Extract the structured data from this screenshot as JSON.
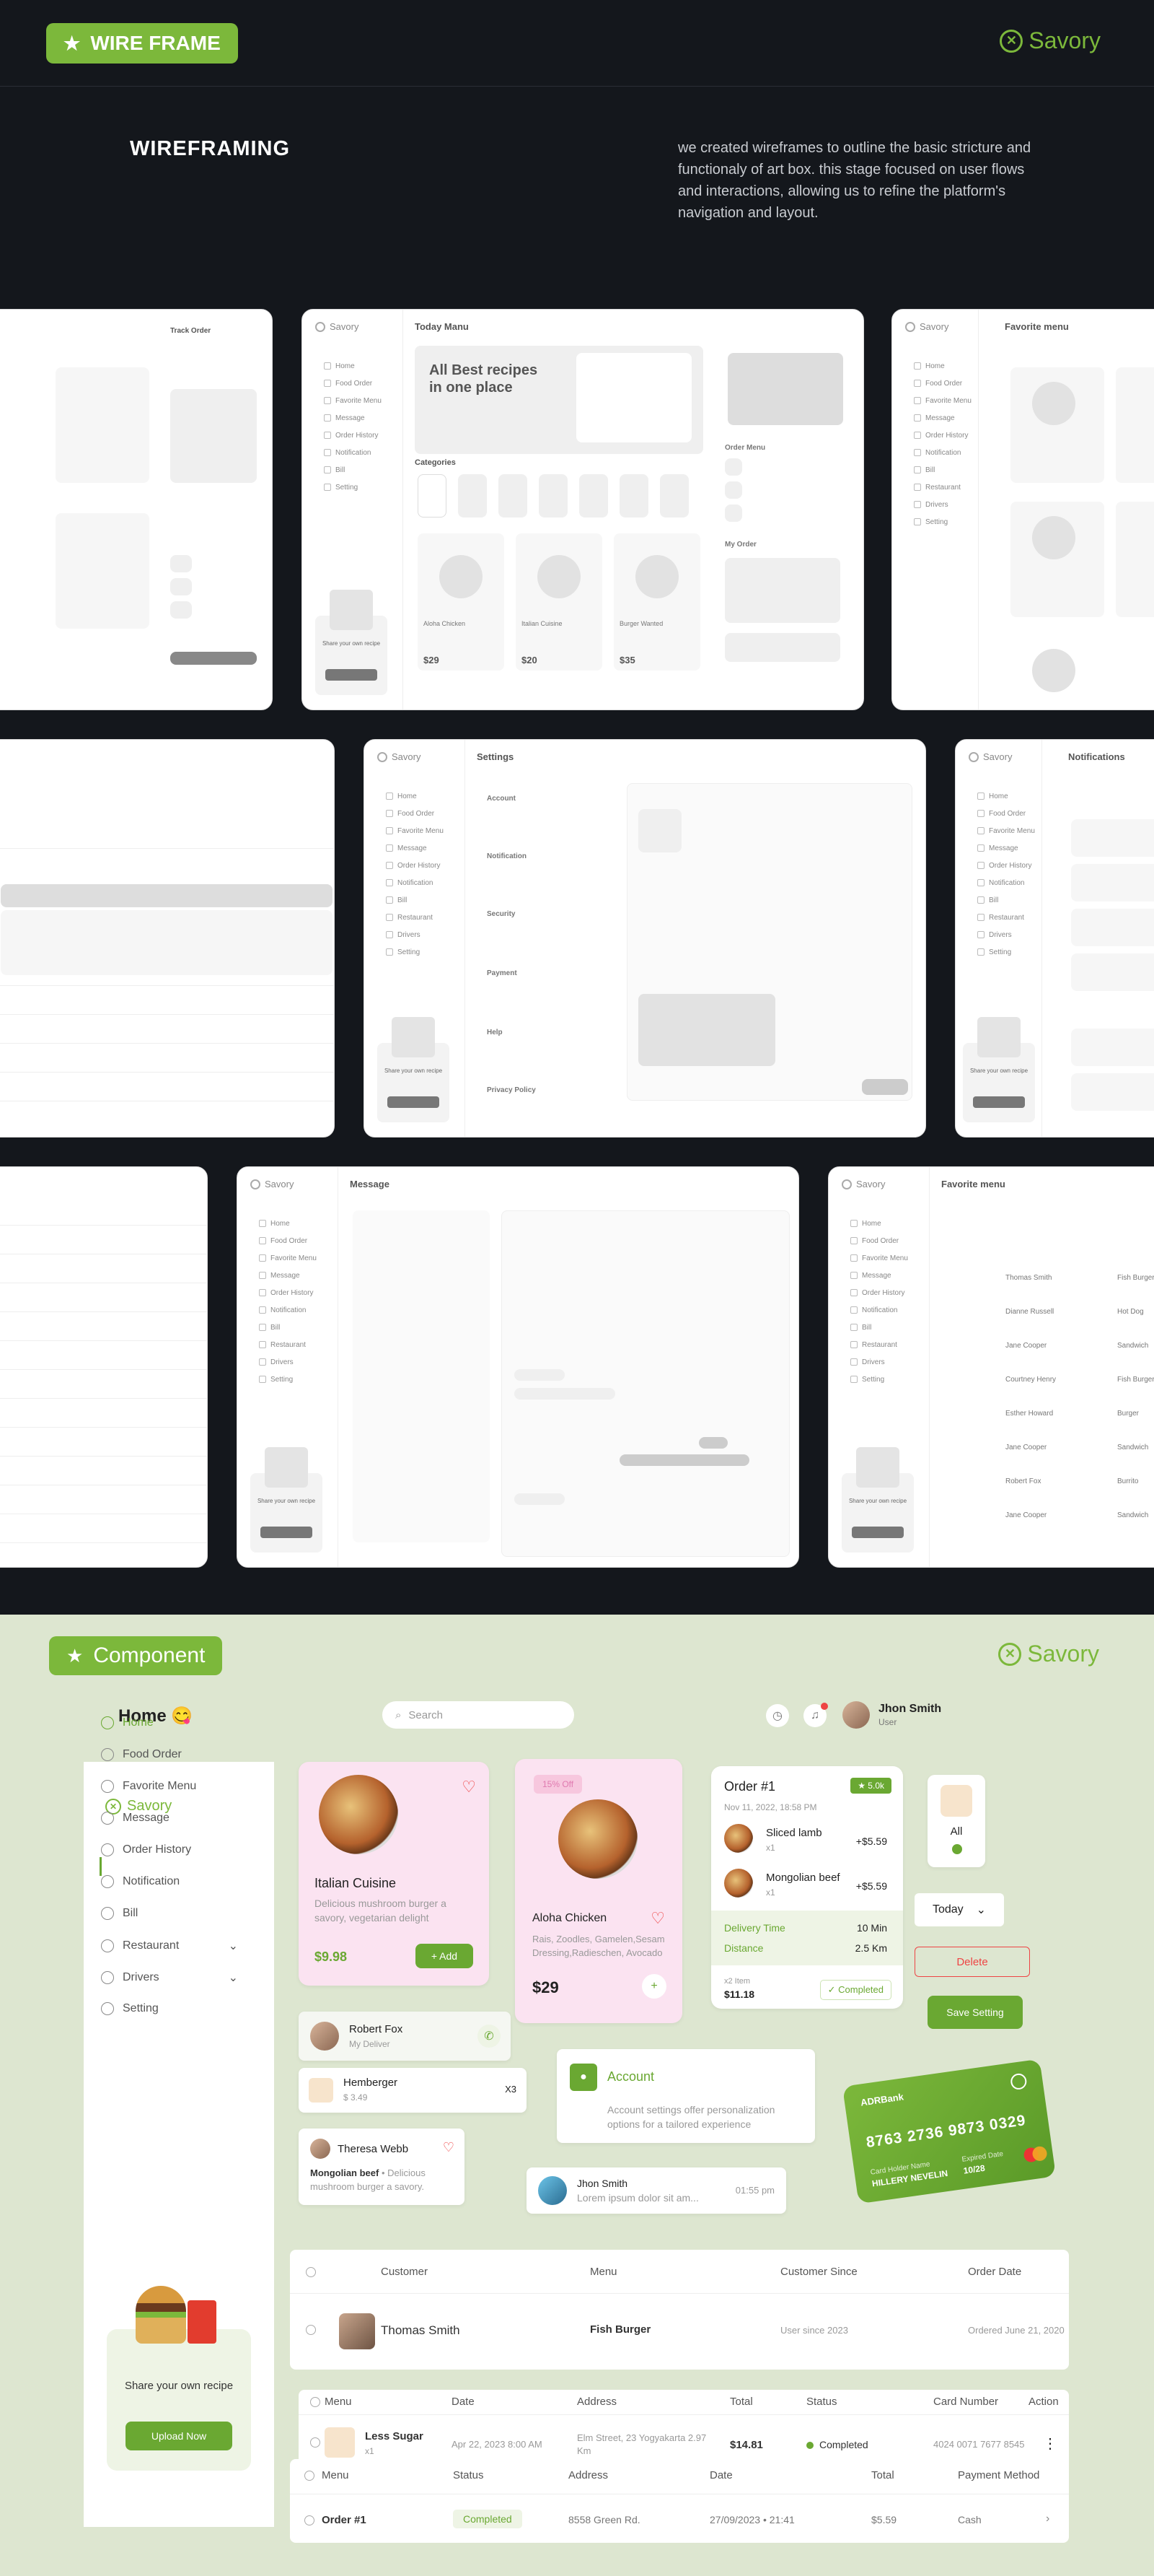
{
  "header": {
    "badge": "WIRE FRAME",
    "brand": "Savory"
  },
  "intro": {
    "title": "WIREFRAMING",
    "text": "we created wireframes to outline the basic stricture and functionaly of art box. this stage focused on user flows and interactions, allowing us to refine the platform's navigation and layout."
  },
  "wire": {
    "today_menu": "Today Manu",
    "hero": "All Best recipes in one place",
    "categories": "Categories",
    "order_menu": "Order Menu",
    "my_order": "My Order",
    "favorite": "Favorite menu",
    "settings": "Settings",
    "notifications": "Notifications",
    "message": "Message",
    "track": "Track Order",
    "account": "Account",
    "notification": "Notification",
    "security": "Security",
    "payment": "Payment",
    "help": "Help",
    "privacy": "Privacy Policy",
    "prices": [
      "$29",
      "$20",
      "$35"
    ],
    "dishes": [
      "Aloha Chicken",
      "Italian Cuisine",
      "Burger Wanted"
    ],
    "nav": [
      "Home",
      "Food Order",
      "Favorite Menu",
      "Message",
      "Order History",
      "Notification",
      "Bill",
      "Restaurant",
      "Drivers",
      "Setting"
    ],
    "names": [
      "Thomas Smith",
      "Dianne Russell",
      "Jane Cooper",
      "Courtney Henry",
      "Esther Howard",
      "Jane Cooper",
      "Robert Fox",
      "Jane Cooper"
    ],
    "menus": [
      "Fish Burger",
      "Hot Dog",
      "Sandwich",
      "Fish Burger",
      "Burger",
      "Sandwich",
      "Burrito",
      "Sandwich"
    ]
  },
  "component": {
    "badge": "Component",
    "brand": "Savory",
    "home": "Home",
    "emoji": "😋",
    "search_placeholder": "Search",
    "user_name": "Jhon Smith",
    "user_role": "User",
    "sidebar": {
      "brand": "Savory",
      "items": [
        "Home",
        "Food Order",
        "Favorite Menu",
        "Message",
        "Order History",
        "Notification",
        "Bill",
        "Restaurant",
        "Drivers",
        "Setting"
      ],
      "share": "Share your own recipe",
      "upload": "Upload Now"
    },
    "italian": {
      "name": "Italian Cuisine",
      "desc": "Delicious mushroom burger a savory, vegetarian delight",
      "price": "$9.98",
      "add": "+ Add"
    },
    "aloha": {
      "tag": "15% Off",
      "name": "Aloha Chicken",
      "desc": "Rais, Zoodles, Gamelen,Sesam Dressing,Radieschen, Avocado",
      "price": "$29",
      "plus": "+"
    },
    "order": {
      "title": "Order #1",
      "badge": "★ 5.0k",
      "date": "Nov 11, 2022, 18:58 PM",
      "items": [
        {
          "name": "Sliced lamb",
          "qty": "x1",
          "price": "+$5.59"
        },
        {
          "name": "Mongolian beef",
          "qty": "x1",
          "price": "+$5.59"
        }
      ],
      "delivery_label": "Delivery Time",
      "delivery": "10 Min",
      "distance_label": "Distance",
      "distance": "2.5 Km",
      "count": "x2 Item",
      "total": "$11.18",
      "status": "✓ Completed"
    },
    "chip": {
      "label": "All"
    },
    "today": "Today",
    "delete": "Delete",
    "save": "Save Setting",
    "driver": {
      "name": "Robert Fox",
      "role": "My Deliver"
    },
    "hemberger": {
      "name": "Hemberger",
      "price": "$ 3.49",
      "qty": "X3"
    },
    "review": {
      "name": "Theresa Webb",
      "dish": "Mongolian beef",
      "text": " • Delicious mushroom burger a savory."
    },
    "account": {
      "title": "Account",
      "text": "Account settings offer personalization options for a tailored experience"
    },
    "message": {
      "name": "Jhon Smith",
      "text": "Lorem ipsum dolor sit am...",
      "time": "01:55 pm"
    },
    "bank": {
      "name": "ADRBank",
      "number": "8763 2736 9873 0329",
      "holder_label": "Card Holder Name",
      "holder": "HILLERY NEVELIN",
      "expiry_label": "Expired Date",
      "expiry": "10/28"
    },
    "customers": {
      "headers": [
        "Customer",
        "Menu",
        "Customer Since",
        "Order Date"
      ],
      "row": [
        "Thomas Smith",
        "Fish Burger",
        "User since 2023",
        "Ordered June 21, 2020"
      ]
    },
    "orders": {
      "headers": [
        "Menu",
        "Date",
        "Address",
        "Total",
        "Status",
        "Card Number",
        "Action"
      ],
      "row": {
        "name": "Less Sugar",
        "qty": "x1",
        "date": "Apr 22, 2023 8:00 AM",
        "address": "Elm Street, 23 Yogyakarta 2.97 Km",
        "total": "$14.81",
        "status": "Completed",
        "card": "4024 0071 7677 8545"
      }
    },
    "history": {
      "headers": [
        "Menu",
        "Status",
        "Address",
        "Date",
        "Total",
        "Payment Method"
      ],
      "row": [
        "Order #1",
        "Completed",
        "8558 Green Rd.",
        "27/09/2023 • 21:41",
        "$5.59",
        "Cash"
      ]
    }
  }
}
